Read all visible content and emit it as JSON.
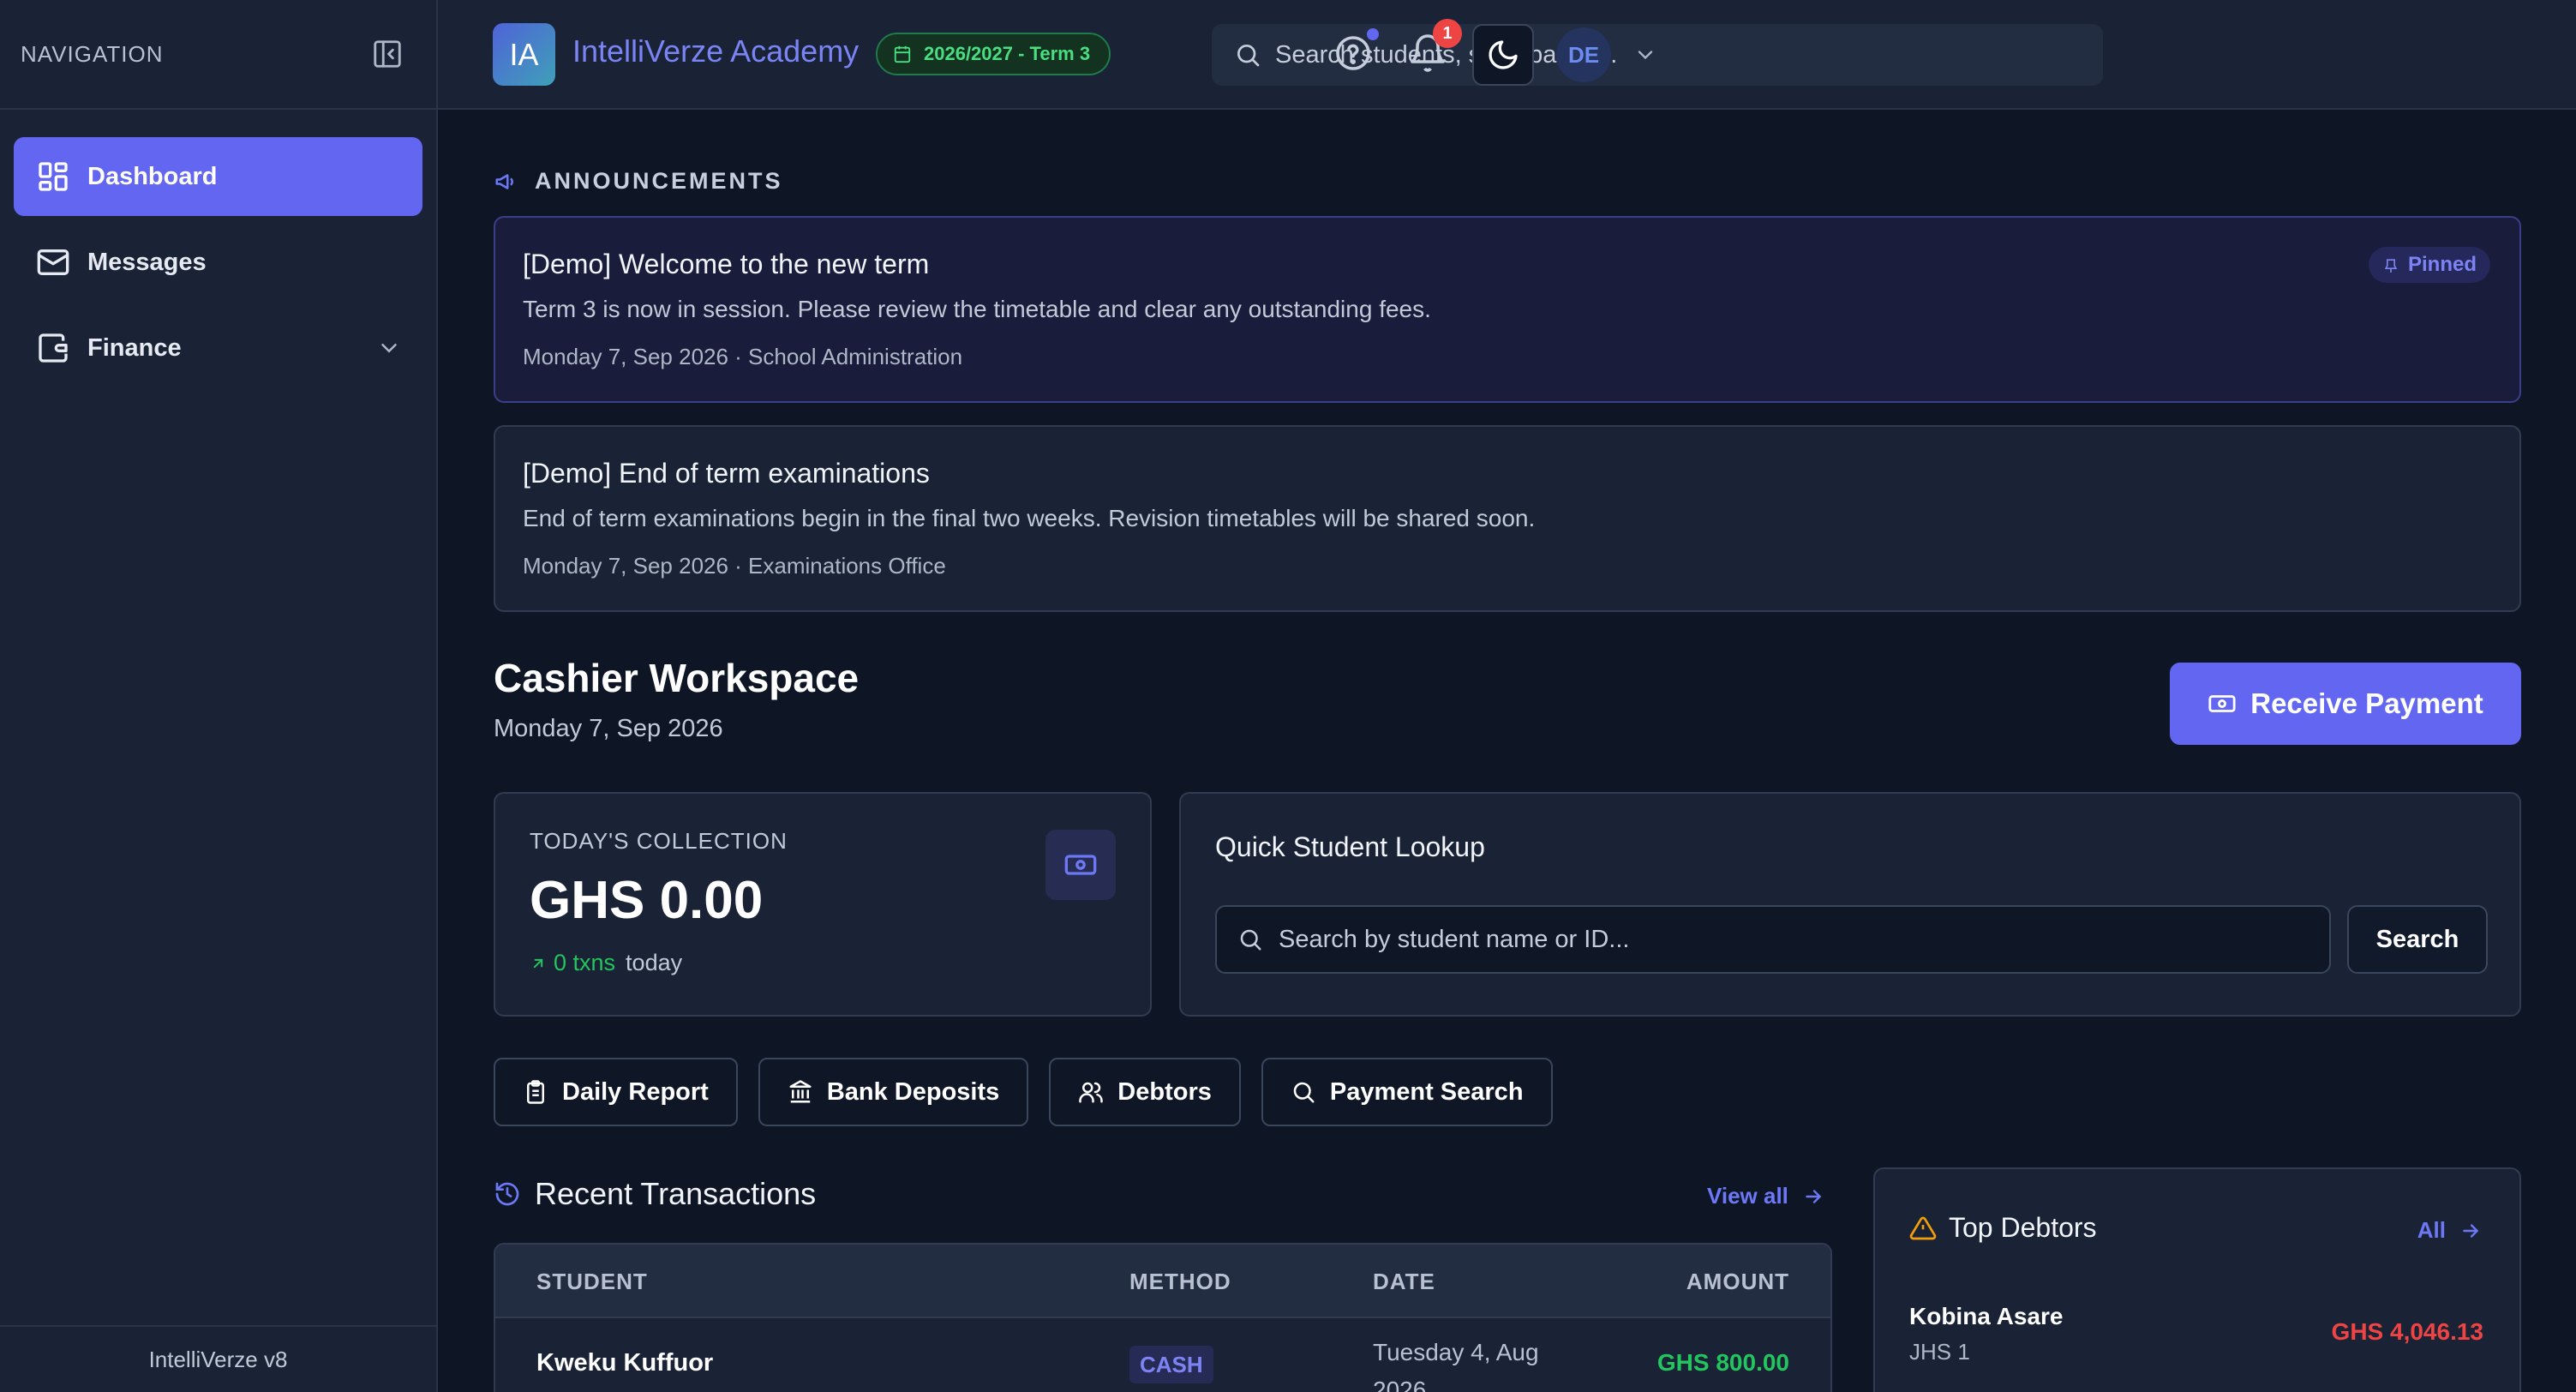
{
  "sidebar": {
    "title": "NAVIGATION",
    "items": [
      {
        "label": "Dashboard",
        "icon": "dashboard-icon",
        "active": true
      },
      {
        "label": "Messages",
        "icon": "mail-icon"
      },
      {
        "label": "Finance",
        "icon": "wallet-icon"
      }
    ],
    "footer": "IntelliVerze v8"
  },
  "topbar": {
    "logo": "IA",
    "brand": "IntelliVerze Academy",
    "term": "2026/2027 - Term 3",
    "search_placeholder": "Search students, staff, pages...",
    "notification_count": "1",
    "avatar": "DE"
  },
  "announcements": {
    "heading": "ANNOUNCEMENTS",
    "items": [
      {
        "title": "[Demo] Welcome to the new term",
        "body": "Term 3 is now in session. Please review the timetable and clear any outstanding fees.",
        "meta": "Monday 7, Sep 2026 · School Administration",
        "badge": "Pinned"
      },
      {
        "title": "[Demo] End of term examinations",
        "body": "End of term examinations begin in the final two weeks. Revision timetables will be shared soon.",
        "meta": "Monday 7, Sep 2026 · Examinations Office"
      }
    ]
  },
  "workspace": {
    "title": "Cashier Workspace",
    "date": "Monday 7, Sep 2026",
    "receive_button": "Receive Payment"
  },
  "collection": {
    "label": "TODAY'S COLLECTION",
    "value": "GHS 0.00",
    "txns": "0 txns",
    "suffix": "today"
  },
  "lookup": {
    "title": "Quick Student Lookup",
    "placeholder": "Search by student name or ID...",
    "button": "Search"
  },
  "actions": [
    {
      "label": "Daily Report",
      "icon": "clipboard-icon"
    },
    {
      "label": "Bank Deposits",
      "icon": "bank-icon"
    },
    {
      "label": "Debtors",
      "icon": "users-icon"
    },
    {
      "label": "Payment Search",
      "icon": "search-icon"
    }
  ],
  "transactions": {
    "title": "Recent Transactions",
    "view_all": "View all",
    "columns": [
      "STUDENT",
      "METHOD",
      "DATE",
      "AMOUNT"
    ],
    "rows": [
      {
        "student": "Kweku Kuffuor",
        "method": "CASH",
        "date": "Tuesday 4, Aug 2026",
        "amount": "GHS 800.00"
      }
    ]
  },
  "debtors": {
    "title": "Top Debtors",
    "all": "All",
    "items": [
      {
        "name": "Kobina Asare",
        "class": "JHS 1",
        "amount": "GHS 4,046.13"
      }
    ]
  },
  "colors": {
    "accent": "#6366f1",
    "background": "#0e1525",
    "panel": "#1a2335",
    "success": "#22c55e",
    "danger": "#ef4444"
  }
}
